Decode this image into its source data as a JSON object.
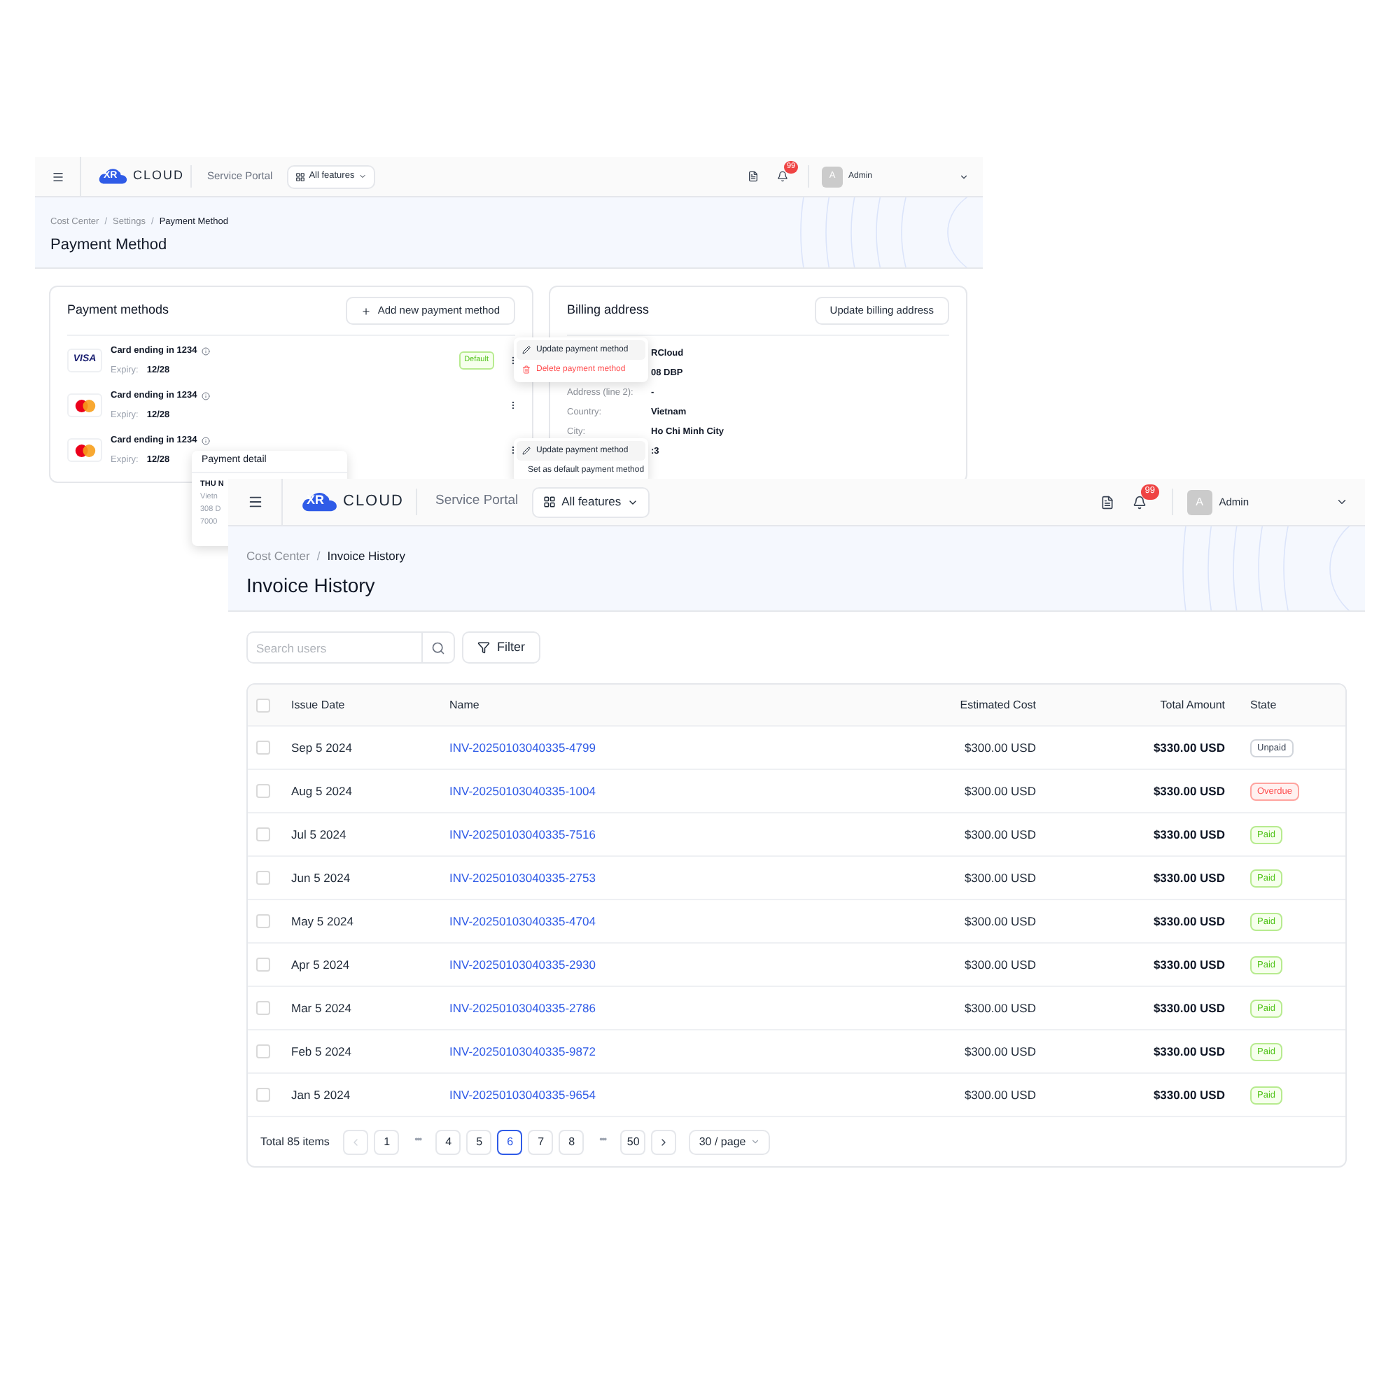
{
  "payment_method_window": {
    "top_bar": {
      "logo_mark": "XR",
      "brand": "CLOUD",
      "portal": "Service Portal",
      "features": "All features",
      "notifications": "99",
      "avatar": "A",
      "user": "Admin"
    },
    "breadcrumb": [
      {
        "label": "Cost Center",
        "current": false
      },
      {
        "label": "Settings",
        "current": false
      },
      {
        "label": "Payment Method",
        "current": true
      }
    ],
    "breadcrumb_separator": "/",
    "title": "Payment Method",
    "payment_methods": {
      "title": "Payment methods",
      "add_button": "Add new payment method",
      "cards": [
        {
          "kind": "visa",
          "logo_text": "VISA",
          "label": "Card ending in 1234",
          "expiry_label": "Expiry:",
          "expiry": "12/28",
          "badge": "Default"
        },
        {
          "kind": "mastercard",
          "label": "Card ending in 1234",
          "expiry_label": "Expiry:",
          "expiry": "12/28"
        },
        {
          "kind": "mastercard",
          "label": "Card ending in 1234",
          "expiry_label": "Expiry:",
          "expiry": "12/28"
        }
      ]
    },
    "billing_address": {
      "title": "Billing address",
      "button": "Update billing address",
      "rows": [
        {
          "value": "RCloud"
        },
        {
          "value": "08 DBP"
        },
        {
          "label": "Address (line 2):",
          "value": "-"
        },
        {
          "label": "Country:",
          "value": "Vietnam"
        },
        {
          "label": "City:",
          "value": "Ho Chi Minh City"
        },
        {
          "value": ":3"
        }
      ]
    },
    "menus": [
      {
        "items": [
          {
            "kind": "edit",
            "label": "Update payment method",
            "danger": false
          },
          {
            "kind": "delete",
            "label": "Delete payment method",
            "danger": true
          }
        ]
      },
      {
        "items": [
          {
            "kind": "edit",
            "label": "Update payment method",
            "danger": false
          },
          {
            "kind": "card",
            "label": "Set as default payment method",
            "danger": false
          }
        ]
      }
    ],
    "tooltip": {
      "title": "Payment detail",
      "lines": [
        "THU N",
        "Vietn",
        "308 D",
        "7000"
      ]
    }
  },
  "invoice_history_window": {
    "top_bar": {
      "logo_mark": "XR",
      "brand": "CLOUD",
      "portal": "Service Portal",
      "features": "All features",
      "notifications": "99",
      "avatar": "A",
      "user": "Admin"
    },
    "breadcrumb": [
      {
        "label": "Cost Center",
        "current": false
      },
      {
        "label": "Invoice History",
        "current": true
      }
    ],
    "breadcrumb_separator": "/",
    "title": "Invoice History",
    "search": {
      "placeholder": "Search users"
    },
    "filter": "Filter",
    "table": {
      "all_checked": false,
      "columns": [
        "Issue Date",
        "Name",
        "Estimated Cost",
        "Total Amount",
        "State"
      ],
      "rows": [
        {
          "checked": false,
          "date": "Sep 5 2024",
          "name": "INV-20250103040335-4799",
          "estimated": "$300.00 USD",
          "total": "$330.00 USD",
          "state": {
            "kind": "unpaid",
            "label": "Unpaid"
          }
        },
        {
          "checked": false,
          "date": "Aug 5 2024",
          "name": "INV-20250103040335-1004",
          "estimated": "$300.00 USD",
          "total": "$330.00 USD",
          "state": {
            "kind": "overdue",
            "label": "Overdue"
          }
        },
        {
          "checked": false,
          "date": "Jul 5 2024",
          "name": "INV-20250103040335-7516",
          "estimated": "$300.00 USD",
          "total": "$330.00 USD",
          "state": {
            "kind": "paid",
            "label": "Paid"
          }
        },
        {
          "checked": false,
          "date": "Jun 5 2024",
          "name": "INV-20250103040335-2753",
          "estimated": "$300.00 USD",
          "total": "$330.00 USD",
          "state": {
            "kind": "paid",
            "label": "Paid"
          }
        },
        {
          "checked": false,
          "date": "May 5 2024",
          "name": "INV-20250103040335-4704",
          "estimated": "$300.00 USD",
          "total": "$330.00 USD",
          "state": {
            "kind": "paid",
            "label": "Paid"
          }
        },
        {
          "checked": false,
          "date": "Apr 5 2024",
          "name": "INV-20250103040335-2930",
          "estimated": "$300.00 USD",
          "total": "$330.00 USD",
          "state": {
            "kind": "paid",
            "label": "Paid"
          }
        },
        {
          "checked": false,
          "date": "Mar 5 2024",
          "name": "INV-20250103040335-2786",
          "estimated": "$300.00 USD",
          "total": "$330.00 USD",
          "state": {
            "kind": "paid",
            "label": "Paid"
          }
        },
        {
          "checked": false,
          "date": "Feb 5 2024",
          "name": "INV-20250103040335-9872",
          "estimated": "$300.00 USD",
          "total": "$330.00 USD",
          "state": {
            "kind": "paid",
            "label": "Paid"
          }
        },
        {
          "checked": false,
          "date": "Jan 5 2024",
          "name": "INV-20250103040335-9654",
          "estimated": "$300.00 USD",
          "total": "$330.00 USD",
          "state": {
            "kind": "paid",
            "label": "Paid"
          }
        }
      ]
    },
    "pagination": {
      "total": "Total 85 items",
      "prev_disabled": true,
      "next_disabled": false,
      "pages": [
        {
          "kind": "page",
          "label": "1",
          "selected": false
        },
        {
          "kind": "ellipsis",
          "label": "•••",
          "selected": false
        },
        {
          "kind": "page",
          "label": "4",
          "selected": false
        },
        {
          "kind": "page",
          "label": "5",
          "selected": false
        },
        {
          "kind": "page",
          "label": "6",
          "selected": true
        },
        {
          "kind": "page",
          "label": "7",
          "selected": false
        },
        {
          "kind": "page",
          "label": "8",
          "selected": false
        },
        {
          "kind": "ellipsis",
          "label": "•••",
          "selected": false
        },
        {
          "kind": "page",
          "label": "50",
          "selected": false
        }
      ],
      "page_size": "30 / page"
    }
  }
}
